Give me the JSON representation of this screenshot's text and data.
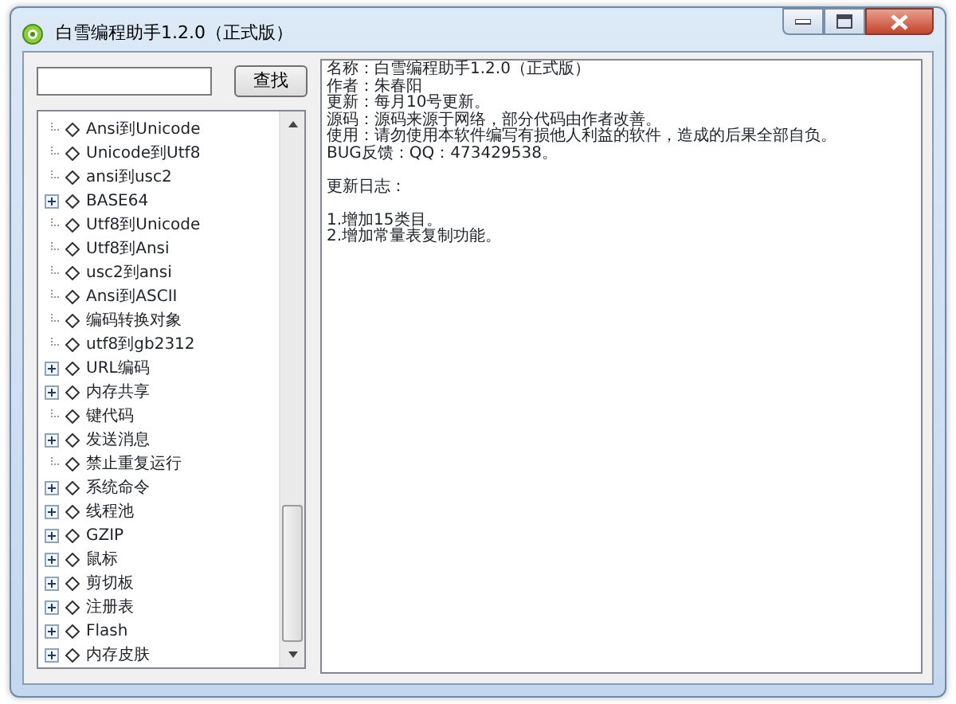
{
  "window": {
    "title": "白雪编程助手1.2.0（正式版）"
  },
  "search": {
    "button": "查找"
  },
  "tree": {
    "items": [
      {
        "label": "Ansi到Unicode",
        "has_children": false
      },
      {
        "label": "Unicode到Utf8",
        "has_children": false
      },
      {
        "label": "ansi到usc2",
        "has_children": false
      },
      {
        "label": "BASE64",
        "has_children": true
      },
      {
        "label": "Utf8到Unicode",
        "has_children": false
      },
      {
        "label": "Utf8到Ansi",
        "has_children": false
      },
      {
        "label": "usc2到ansi",
        "has_children": false
      },
      {
        "label": "Ansi到ASCII",
        "has_children": false
      },
      {
        "label": "编码转换对象",
        "has_children": false
      },
      {
        "label": "utf8到gb2312",
        "has_children": false
      },
      {
        "label": "URL编码",
        "has_children": true
      },
      {
        "label": "内存共享",
        "has_children": true
      },
      {
        "label": "键代码",
        "has_children": false
      },
      {
        "label": "发送消息",
        "has_children": true
      },
      {
        "label": "禁止重复运行",
        "has_children": false
      },
      {
        "label": "系统命令",
        "has_children": true
      },
      {
        "label": "线程池",
        "has_children": true
      },
      {
        "label": "GZIP",
        "has_children": true
      },
      {
        "label": "鼠标",
        "has_children": true
      },
      {
        "label": "剪切板",
        "has_children": true
      },
      {
        "label": "注册表",
        "has_children": true
      },
      {
        "label": "Flash",
        "has_children": true
      },
      {
        "label": "内存皮肤",
        "has_children": true
      }
    ]
  },
  "details": {
    "paragraphs": [
      [
        "名称：白雪编程助手1.2.0（正式版）",
        "作者：朱春阳",
        "更新：每月10号更新。",
        "源码：源码来源于网络，部分代码由作者改善。",
        "使用：请勿使用本软件编写有损他人利益的软件，造成的后果全部自负。",
        "BUG反馈：QQ：473429538。"
      ],
      [
        "更新日志："
      ],
      [
        "1.增加15类目。",
        "2.增加常量表复制功能。"
      ]
    ]
  }
}
